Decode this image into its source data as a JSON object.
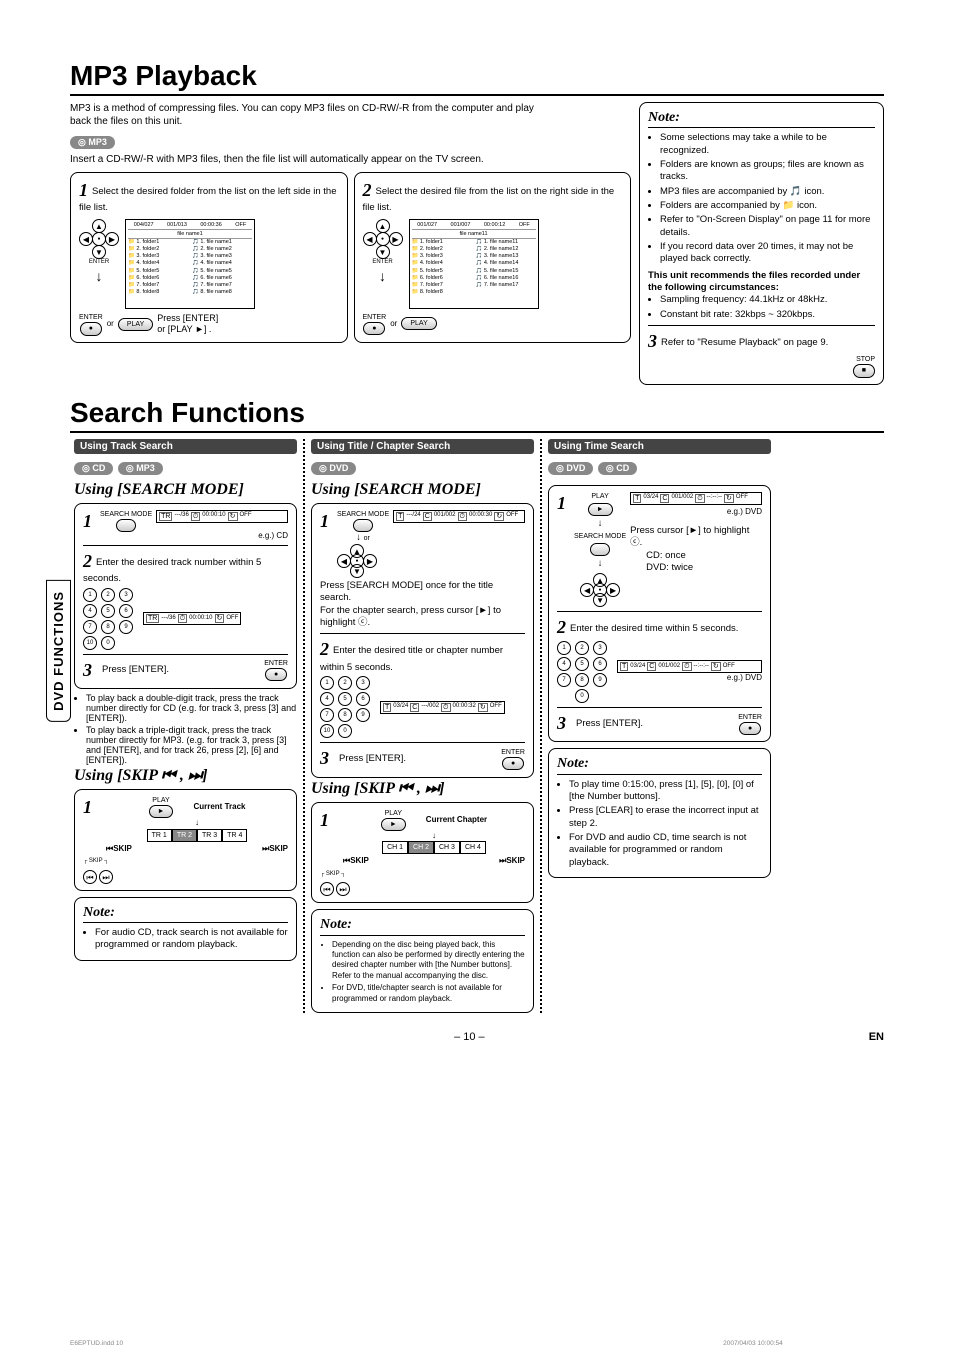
{
  "mp3": {
    "title": "MP3 Playback",
    "intro": "MP3 is a method of compressing files. You can copy MP3 files on CD-RW/-R from the computer and play back the files on this unit.",
    "badge": "MP3",
    "insert_line": "Insert a CD-RW/-R with MP3 files, then the file list will automatically appear on the TV screen.",
    "step1": {
      "text": "Select the desired folder from the list on the left side in the file list.",
      "display_top": [
        "004/027",
        "001/013",
        "00:00:36",
        "OFF"
      ],
      "display_name": "file name1",
      "folders": [
        "1. folder1",
        "2. folder2",
        "3. folder3",
        "4. folder4",
        "5. folder5",
        "6. folder6",
        "7. folder7",
        "8. folder8"
      ],
      "files": [
        "1. file name1",
        "2. file name2",
        "3. file name3",
        "4. file name4",
        "5. file name5",
        "6. file name6",
        "7. file name7",
        "8. file name8"
      ],
      "enter_label": "ENTER",
      "or": "or",
      "play_label": "PLAY",
      "press": "Press [ENTER]",
      "orplay": "or [PLAY ►] ."
    },
    "step2": {
      "text": "Select the desired file from the list on the right side in the file list.",
      "display_top": [
        "001/027",
        "001/007",
        "00:00:12",
        "OFF"
      ],
      "display_name": "file name11",
      "folders": [
        "1. folder1",
        "2. folder2",
        "3. folder3",
        "4. folder4",
        "5. folder5",
        "6. folder6",
        "7. folder7",
        "8. folder8"
      ],
      "files": [
        "1. file name11",
        "2. file name12",
        "3. file name13",
        "4. file name14",
        "5. file name15",
        "6. file name16",
        "7. file name17"
      ],
      "enter_label": "ENTER",
      "or": "or",
      "play_label": "PLAY"
    },
    "note": {
      "title": "Note:",
      "bullets": [
        "Some selections may take a while to be recognized.",
        "Folders are known as groups; files are known as tracks.",
        "MP3 files are accompanied by 🎵 icon.",
        "Folders are accompanied by 📁 icon.",
        "Refer to \"On-Screen Display\" on page 11 for more details.",
        "If you record data over 20 times, it may not be played back correctly."
      ],
      "rec_line": "This unit recommends the files recorded under the following circumstances:",
      "rec_bullets": [
        "Sampling frequency: 44.1kHz or 48kHz.",
        "Constant bit rate: 32kbps ~ 320kbps."
      ],
      "step3": "Refer to \"Resume Playback\" on page 9.",
      "stop_label": "STOP"
    }
  },
  "search": {
    "title": "Search Functions",
    "track": {
      "bar": "Using Track Search",
      "badges": [
        "CD",
        "MP3"
      ],
      "using": "Using [SEARCH MODE]",
      "s1_search": "SEARCH MODE",
      "s1_disp": [
        "---/36",
        "00:00:10",
        "OFF"
      ],
      "s1_eg": "e.g.) CD",
      "s2_text": "Enter the desired track number within 5 seconds.",
      "s2_disp": [
        "---/36",
        "00:00:10",
        "OFF"
      ],
      "s3_text": "Press [ENTER].",
      "bul1": "To play back a double-digit track, press the track number directly for CD (e.g. for track 3, press [3] and [ENTER]).",
      "bul2": "To play back a triple-digit track, press the track number directly for MP3. (e.g. for track 3, press [3] and [ENTER], and for track 26, press [2], [6] and [ENTER]).",
      "skip_head": "Using [SKIP ⏮ , ⏭]",
      "play_label": "PLAY",
      "cur_label": "Current Track",
      "tracks": [
        "TR 1",
        "TR 2",
        "TR 3",
        "TR 4"
      ],
      "skip_l_top": "SKIP",
      "skip_l": "⏮SKIP",
      "skip_r": "⏭SKIP",
      "note_title": "Note:",
      "note_text": "For audio CD, track search is not available for programmed or random playback."
    },
    "chapter": {
      "bar": "Using Title / Chapter Search",
      "badges": [
        "DVD"
      ],
      "using": "Using [SEARCH MODE]",
      "s1_search": "SEARCH MODE",
      "s1_disp": [
        "---/24",
        "001/002",
        "00:00:30",
        "OFF"
      ],
      "s1_or": "or",
      "s1_press": "Press [SEARCH MODE] once for the title search.",
      "s1_press2": "For the chapter search, press cursor [►] to highlight ⓒ.",
      "s2_text": "Enter the desired title or chapter number within 5 seconds.",
      "s2_disp": [
        "03/24",
        "---/002",
        "00:00:32",
        "OFF"
      ],
      "s3_text": "Press [ENTER].",
      "skip_head": "Using [SKIP ⏮ , ⏭]",
      "play_label": "PLAY",
      "cur_label": "Current Chapter",
      "tracks": [
        "CH 1",
        "CH 2",
        "CH 3",
        "CH 4"
      ],
      "skip_l_top": "SKIP",
      "skip_l": "⏮SKIP",
      "skip_r": "⏭SKIP",
      "note_title": "Note:",
      "note_b1": "Depending on the disc being played back, this function can also be performed by directly entering the desired chapter number with [the Number buttons]. Refer to the manual accompanying the disc.",
      "note_b2": "For DVD, title/chapter search is not available for programmed or random playback."
    },
    "time": {
      "bar": "Using Time Search",
      "badges": [
        "DVD",
        "CD"
      ],
      "s1_play": "PLAY",
      "s1_disp1": [
        "03/24",
        "001/002",
        "--:--:--",
        "OFF"
      ],
      "s1_eg1": "e.g.) DVD",
      "s1_search": "SEARCH MODE",
      "s1_pc": "Press cursor [►] to highlight ⓒ.",
      "s1_cd": "CD: once",
      "s1_dvd": "DVD: twice",
      "s2_text": "Enter the desired time within 5 seconds.",
      "s2_disp": [
        "03/24",
        "001/002",
        "--:--:--",
        "OFF"
      ],
      "s2_eg": "e.g.) DVD",
      "s3_text": "Press [ENTER].",
      "note_title": "Note:",
      "note_b1": "To play time 0:15:00, press [1], [5], [0], [0] of [the Number buttons].",
      "note_b2": "Press [CLEAR] to erase the incorrect input at step 2.",
      "note_b3": "For DVD and audio CD, time search is not available for programmed or random playback."
    }
  },
  "sidebar": "DVD FUNCTIONS",
  "footer": {
    "page": "– 10 –",
    "lang": "EN",
    "file": "E6EPTUD.indd   10",
    "ts": "2007/04/03   10:00:54"
  }
}
